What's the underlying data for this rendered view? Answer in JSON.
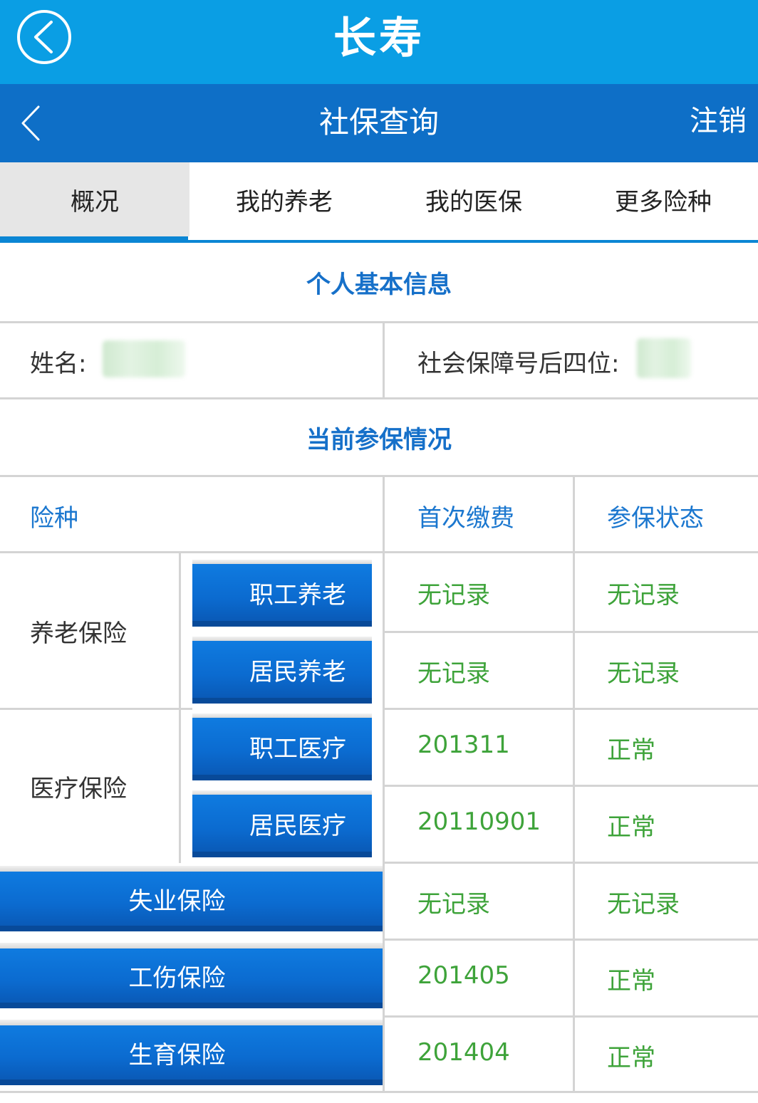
{
  "appbar": {
    "title": "长寿",
    "back_icon": "circle-chevron-left-icon"
  },
  "subbar": {
    "title": "社保查询",
    "logout": "注销",
    "back_icon": "chevron-left-icon"
  },
  "tabs": [
    {
      "label": "概况",
      "active": true
    },
    {
      "label": "我的养老",
      "active": false
    },
    {
      "label": "我的医保",
      "active": false
    },
    {
      "label": "更多险种",
      "active": false
    }
  ],
  "basic": {
    "title": "个人基本信息",
    "name_label": "姓名:",
    "ssn_label": "社会保障号后四位:"
  },
  "current": {
    "title": "当前参保情况",
    "headers": {
      "type": "险种",
      "first_payment": "首次缴费",
      "status": "参保状态"
    },
    "pension": {
      "group": "养老保险",
      "rows": [
        {
          "name": "职工养老",
          "first_payment": "无记录",
          "status": "无记录"
        },
        {
          "name": "居民养老",
          "first_payment": "无记录",
          "status": "无记录"
        }
      ]
    },
    "medical": {
      "group": "医疗保险",
      "rows": [
        {
          "name": "职工医疗",
          "first_payment": "201311",
          "status": "正常"
        },
        {
          "name": "居民医疗",
          "first_payment": "20110901",
          "status": "正常"
        }
      ]
    },
    "others": [
      {
        "name": "失业保险",
        "first_payment": "无记录",
        "status": "无记录"
      },
      {
        "name": "工伤保险",
        "first_payment": "201405",
        "status": "正常"
      },
      {
        "name": "生育保险",
        "first_payment": "201404",
        "status": "正常"
      }
    ]
  },
  "colors": {
    "appbar": "#0a9ee4",
    "subbar": "#0e6fc7",
    "accent": "#1670c9",
    "value_green": "#3ea33a"
  }
}
